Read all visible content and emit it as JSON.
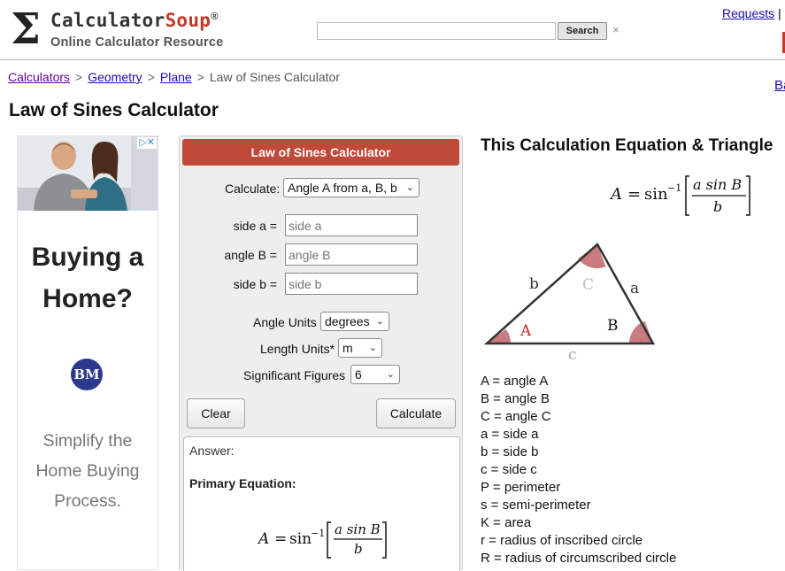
{
  "header": {
    "brand_prefix": "Calculator",
    "brand_suffix": "Soup",
    "brand_reg": "®",
    "tagline": "Online Calculator Resource",
    "search_placeholder": "",
    "search_button": "Search",
    "search_clear": "×",
    "requests_link": "Requests",
    "requests_sep": "|"
  },
  "breadcrumb": {
    "items": [
      "Calculators",
      "Geometry",
      "Plane"
    ],
    "current": "Law of Sines Calculator",
    "separator": ">"
  },
  "side_link": "Ba",
  "page_title": "Law of Sines Calculator",
  "ad": {
    "badge": "▷✕",
    "headline_line1": "Buying a",
    "headline_line2": "Home?",
    "logo_text": "BM",
    "sub_line1": "Simplify the",
    "sub_line2": "Home Buying",
    "sub_line3": "Process."
  },
  "calculator": {
    "header": "Law of Sines Calculator",
    "calculate_label": "Calculate:",
    "calculate_value": "Angle A from a, B, b",
    "side_a_label": "side a =",
    "side_a_placeholder": "side a",
    "angle_b_label": "angle B =",
    "angle_b_placeholder": "angle B",
    "side_b_label": "side b =",
    "side_b_placeholder": "side b",
    "angle_units_label": "Angle Units",
    "angle_units_value": "degrees",
    "length_units_label": "Length Units*",
    "length_units_value": "m",
    "sig_figs_label": "Significant Figures",
    "sig_figs_value": "6",
    "clear_button": "Clear",
    "calculate_button": "Calculate",
    "answer_label": "Answer:",
    "primary_equation_label": "Primary Equation:"
  },
  "equation": {
    "title": "This Calculation Equation & Triangle",
    "lhs": "A",
    "equals": "=",
    "func": "sin",
    "exponent": "−1",
    "numerator": "a sin B",
    "denominator": "b"
  },
  "triangle": {
    "vertex_A": "A",
    "vertex_B": "B",
    "vertex_C": "C",
    "side_a": "a",
    "side_b": "b",
    "side_c": "c",
    "angle_fill": "#c97b80",
    "vertex_A_color": "#cc2222",
    "vertex_C_color": "#bbbbbb",
    "side_c_color": "#aaaaaa"
  },
  "legend": [
    "A = angle A",
    "B = angle B",
    "C = angle C",
    "a = side a",
    "b = side b",
    "c = side c",
    "P = perimeter",
    "s = semi-perimeter",
    "K = area",
    "r = radius of inscribed circle",
    "R = radius of circumscribed circle"
  ],
  "colors": {
    "brand_red": "#c0392b",
    "calc_header_bg": "#bf4a3a",
    "link": "#1a0dab",
    "visited_link": "#660099"
  }
}
